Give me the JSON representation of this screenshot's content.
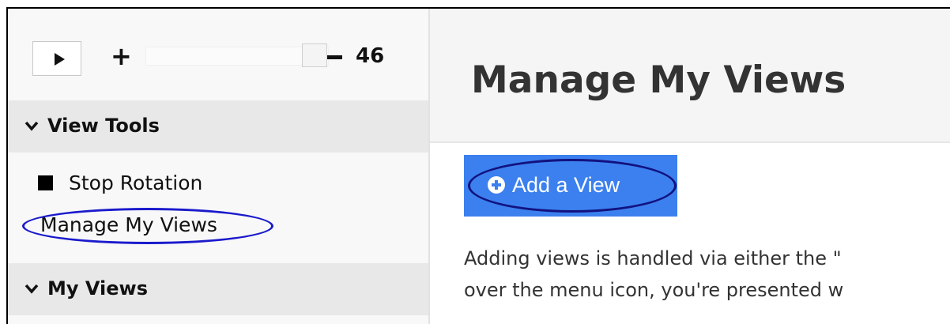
{
  "controls": {
    "plus": "+",
    "count": "46"
  },
  "sidebar": {
    "view_tools": {
      "title": "View Tools"
    },
    "items": [
      {
        "label": "Stop Rotation"
      },
      {
        "label": "Manage My Views"
      }
    ],
    "my_views": {
      "title": "My Views"
    }
  },
  "main": {
    "title": "Manage My Views",
    "add_button": "Add a View",
    "paragraph": [
      "Adding views is handled via either the \"",
      "over the menu icon, you're presented w"
    ]
  },
  "colors": {
    "button_bg": "#3b80ee",
    "highlight_ellipse": "#1a1acc",
    "section_header_bg": "#e8e8e8"
  }
}
